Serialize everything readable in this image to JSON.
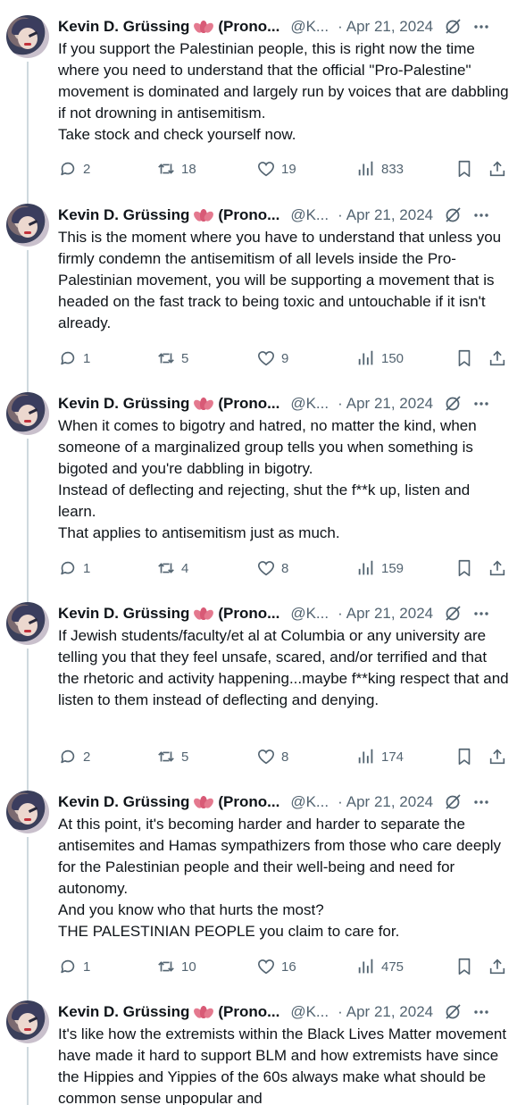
{
  "colors": {
    "text": "#0f1419",
    "secondary": "#536471",
    "thread_line": "#cfd9de",
    "lotus": "#e4798f"
  },
  "author": {
    "name": "Kevin D. Grüssing",
    "name_suffix": "(Prono...",
    "handle": "@K...",
    "emoji_icon": "lotus-icon"
  },
  "tweets": [
    {
      "date": "Apr 21, 2024",
      "text": "If you support the Palestinian people, this is right now the time where you need to understand that the official \"Pro-Palestine\" movement is dominated and largely run by voices that are dabbling if not drowning in antisemitism.\nTake stock and check yourself now.",
      "replies": "2",
      "retweets": "18",
      "likes": "19",
      "views": "833"
    },
    {
      "date": "Apr 21, 2024",
      "text": "This is the moment where you have to understand that unless you firmly condemn the antisemitism of all levels inside the Pro-Palestinian movement, you will be supporting a movement that is headed on the fast track to being toxic and untouchable if it isn't already.",
      "replies": "1",
      "retweets": "5",
      "likes": "9",
      "views": "150"
    },
    {
      "date": "Apr 21, 2024",
      "text": "When it comes to bigotry and hatred, no matter the kind, when someone of a marginalized group tells you when something is bigoted and you're dabbling in bigotry.\nInstead of deflecting and rejecting, shut the f**k up, listen and learn.\nThat applies to antisemitism just as much.",
      "replies": "1",
      "retweets": "4",
      "likes": "8",
      "views": "159"
    },
    {
      "date": "Apr 21, 2024",
      "text": "If Jewish students/faculty/et al at Columbia or any university are telling you that they feel unsafe, scared, and/or terrified and that the rhetoric and activity happening...maybe f**king respect that and listen to them instead of deflecting and denying.",
      "replies": "2",
      "retweets": "5",
      "likes": "8",
      "views": "174"
    },
    {
      "date": "Apr 21, 2024",
      "text": "At this point, it's becoming harder and harder to separate the antisemites and Hamas sympathizers from those who care deeply for the Palestinian people and their well-being and need for autonomy.\nAnd you know who that hurts the most?\nTHE PALESTINIAN PEOPLE you claim to care for.",
      "replies": "1",
      "retweets": "10",
      "likes": "16",
      "views": "475"
    },
    {
      "date": "Apr 21, 2024",
      "text": "It's like how the extremists within the Black Lives Matter movement have made it hard to support BLM and how extremists have since the Hippies and Yippies of the 60s always make what should be common sense unpopular and"
    }
  ]
}
